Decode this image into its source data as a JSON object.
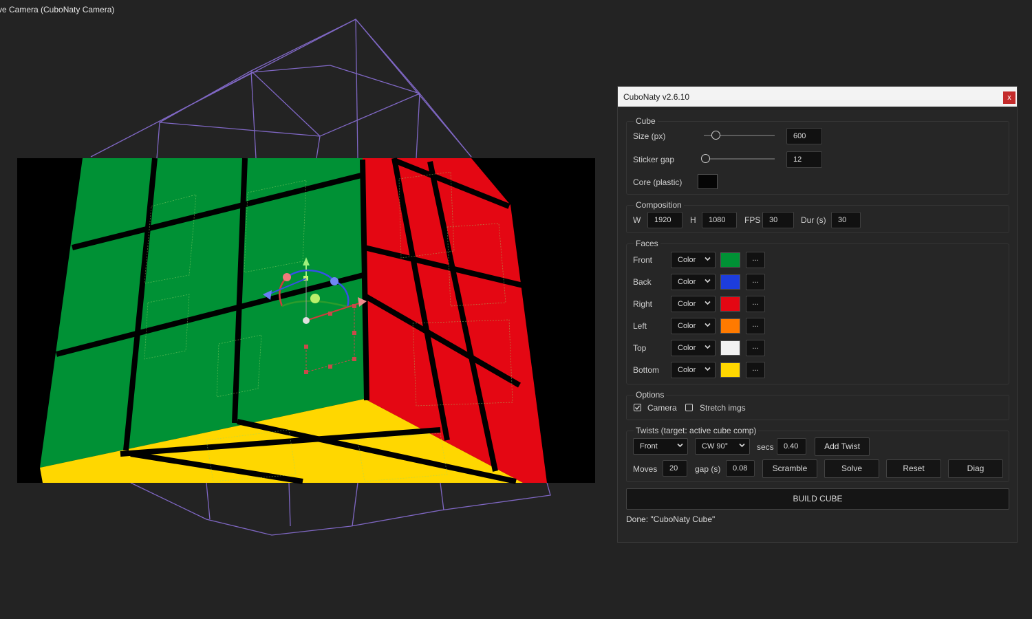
{
  "viewport": {
    "camera_label": "ve Camera (CuboNaty Camera)"
  },
  "face_colors": {
    "front": "#009135",
    "back": "#1d3ddc",
    "right": "#e40713",
    "left": "#ff7a00",
    "top": "#f2f2f2",
    "bottom": "#ffd700",
    "core": "#050505"
  },
  "panel": {
    "title": "CuboNaty v2.6.10",
    "close_label": "x",
    "cube": {
      "group_label": "Cube",
      "size_label": "Size (px)",
      "size_value": "600",
      "sticker_gap_label": "Sticker gap",
      "sticker_gap_value": "12",
      "core_label": "Core (plastic)"
    },
    "composition": {
      "group_label": "Composition",
      "w_label": "W",
      "w_value": "1920",
      "h_label": "H",
      "h_value": "1080",
      "fps_label": "FPS",
      "fps_value": "30",
      "dur_label": "Dur (s)",
      "dur_value": "30"
    },
    "faces": {
      "group_label": "Faces",
      "rows": [
        {
          "label": "Front",
          "mode": "Color",
          "more": "..."
        },
        {
          "label": "Back",
          "mode": "Color",
          "more": "..."
        },
        {
          "label": "Right",
          "mode": "Color",
          "more": "..."
        },
        {
          "label": "Left",
          "mode": "Color",
          "more": "..."
        },
        {
          "label": "Top",
          "mode": "Color",
          "more": "..."
        },
        {
          "label": "Bottom",
          "mode": "Color",
          "more": "..."
        }
      ]
    },
    "options": {
      "group_label": "Options",
      "camera_label": "Camera",
      "camera_checked": true,
      "stretch_label": "Stretch imgs",
      "stretch_checked": false
    },
    "twists": {
      "group_label": "Twists  (target: active cube comp)",
      "face_select": "Front",
      "dir_select": "CW 90°",
      "secs_label": "secs",
      "secs_value": "0.40",
      "add_twist": "Add Twist",
      "moves_label": "Moves",
      "moves_value": "20",
      "gap_label": "gap (s)",
      "gap_value": "0.08",
      "scramble": "Scramble",
      "solve": "Solve",
      "reset": "Reset",
      "diag": "Diag"
    },
    "build_button": "BUILD CUBE",
    "status": "Done: \"CuboNaty Cube\""
  }
}
